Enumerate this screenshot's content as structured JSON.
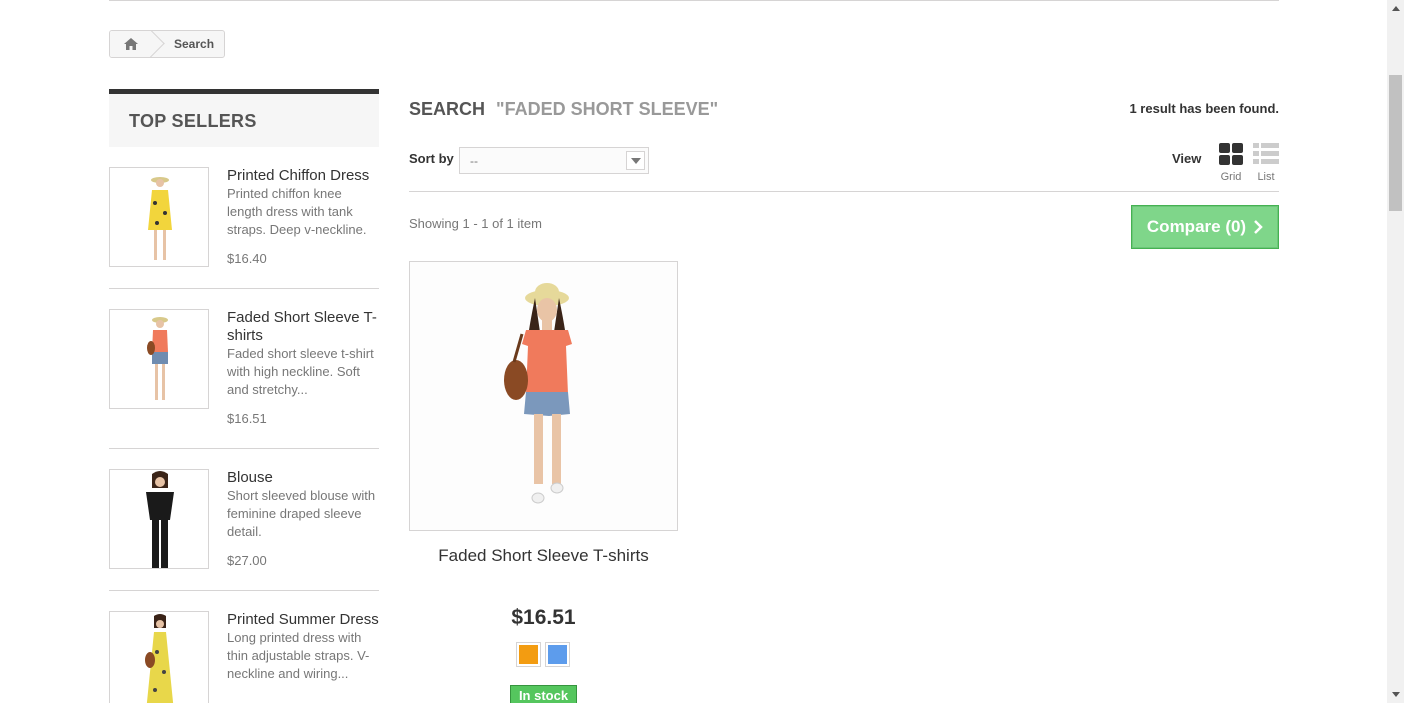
{
  "breadcrumb": {
    "current": "Search"
  },
  "top_sellers": {
    "title": "TOP SELLERS",
    "items": [
      {
        "name": "Printed Chiffon Dress",
        "desc": "Printed chiffon knee length dress with tank straps. Deep v-neckline.",
        "price": "$16.40"
      },
      {
        "name": "Faded Short Sleeve T-shirts",
        "desc": "Faded short sleeve t-shirt with high neckline. Soft and stretchy...",
        "price": "$16.51"
      },
      {
        "name": "Blouse",
        "desc": "Short sleeved blouse with feminine draped sleeve detail.",
        "price": "$27.00"
      },
      {
        "name": "Printed Summer Dress",
        "desc": "Long printed dress with thin adjustable straps. V-neckline and wiring...",
        "price": ""
      }
    ]
  },
  "search": {
    "label": "SEARCH",
    "term": "\"FADED SHORT SLEEVE\"",
    "result_count": "1 result has been found."
  },
  "sort": {
    "label": "Sort by",
    "selected": "--"
  },
  "view": {
    "label": "View",
    "grid": "Grid",
    "list": "List"
  },
  "showing": "Showing 1 - 1 of 1 item",
  "compare": {
    "label": "Compare (0)"
  },
  "product": {
    "name": "Faded Short Sleeve T-shirts",
    "price": "$16.51",
    "swatch_colors": [
      "#f39c11",
      "#5d9cec"
    ],
    "stock": "In stock"
  }
}
